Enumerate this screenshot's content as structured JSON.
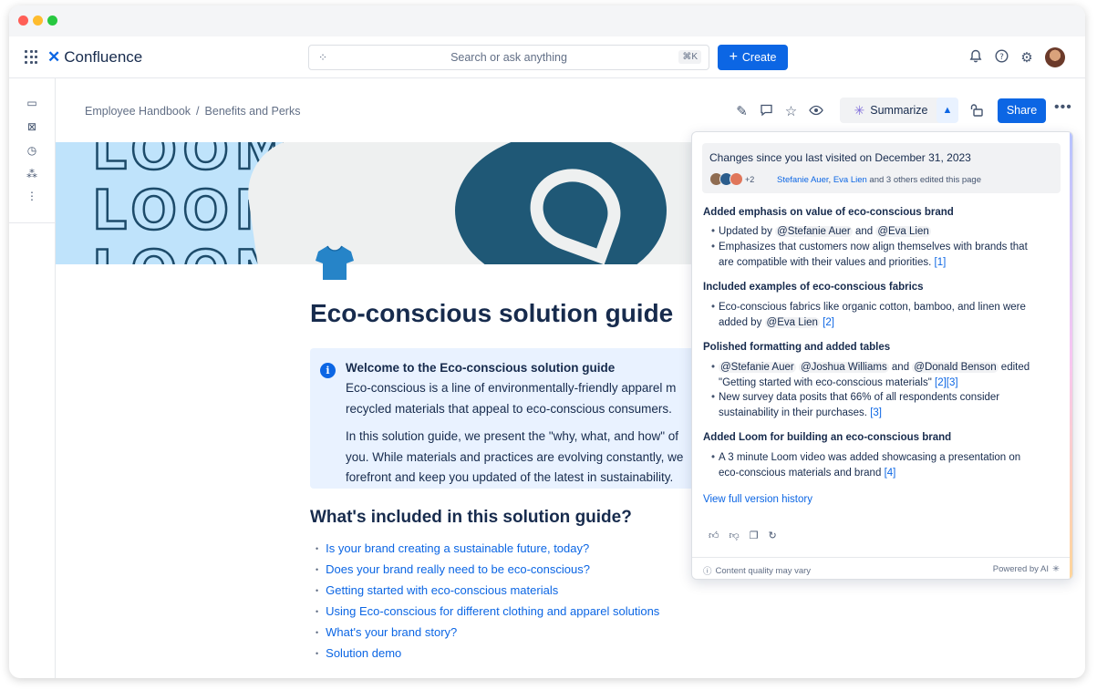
{
  "window": {
    "dots": [
      "#ff5f57",
      "#febc2e",
      "#28c840"
    ]
  },
  "topnav": {
    "app_name": "Confluence",
    "search_placeholder": "Search or ask anything",
    "search_shortcut": "⌘K",
    "create_label": "Create",
    "icons": [
      "bell-icon",
      "help-icon",
      "settings-icon",
      "avatar"
    ]
  },
  "sidebar": {
    "icons": [
      "sidebar-icon",
      "pages-icon",
      "recent-icon",
      "apps-icon",
      "more-icon"
    ]
  },
  "breadcrumb": {
    "items": [
      "Employee Handbook",
      "/",
      "Benefits and Perks"
    ]
  },
  "toolbar": {
    "summarize_label": "Summarize",
    "share_label": "Share"
  },
  "page": {
    "title": "Eco-conscious solution guide",
    "info": {
      "title": "Welcome to the Eco-conscious solution guide",
      "lines": [
        "Eco-conscious is a line of environmentally-friendly apparel m",
        "recycled materials that appeal to eco-conscious consumers.",
        "In this solution guide, we present the \"why, what, and how\" of",
        "you. While materials and practices are evolving constantly, we",
        "forefront and keep you updated of the latest in sustainability."
      ]
    },
    "section_title": "What's included in this solution guide?",
    "toc": [
      "Is your brand creating a sustainable future, today?",
      "Does your brand really need to be eco-conscious?",
      "Getting started with eco-conscious materials",
      "Using Eco-conscious for different clothing and apparel solutions",
      "What's your brand story?",
      "Solution demo"
    ]
  },
  "ai_summary": {
    "changes_title": "Changes since you last visited on December 31, 2023",
    "avatar_extra": "+2",
    "editor_1": "Stefanie Auer",
    "editor_sep": ", ",
    "editor_2": "Eva Lien",
    "editors_suffix": " and 3 others edited this page",
    "s1": {
      "heading": "Added emphasis on value of eco-conscious brand",
      "b1_pre": "Updated by ",
      "b1_m1": "@Stefanie Auer",
      "b1_mid": " and ",
      "b1_m2": "@Eva Lien",
      "b2_l1": "Emphasizes that customers now align themselves with brands that",
      "b2_l2": "are compatible with their values and priorities.",
      "b2_ref": "[1]"
    },
    "s2": {
      "heading": "Included examples of eco-conscious fabrics",
      "b1_l1": "Eco-conscious fabrics like organic cotton, bamboo, and linen were",
      "b1_l2_pre": "added by ",
      "b1_m": "@Eva Lien",
      "b1_ref": "[2]"
    },
    "s3": {
      "heading": "Polished formatting and added tables",
      "b1_m1": "@Stefanie Auer",
      "b1_m2": "@Joshua Williams",
      "b1_and": " and ",
      "b1_m3": "@Donald Benson",
      "b1_edited": " edited",
      "b1_l2": "\"Getting started with eco-conscious materials\"",
      "b1_refs": "[2][3]",
      "b2_l1": "New survey data posits that 66% of all respondents consider",
      "b2_l2": "sustainability in their purchases.",
      "b2_ref": "[3]"
    },
    "s4": {
      "heading": "Added Loom for building an eco-conscious brand",
      "b1_l1": "A 3 minute Loom video was added showcasing a presentation on",
      "b1_l2": "eco-conscious materials and brand",
      "b1_ref": "[4]"
    },
    "version_history": "View full version history",
    "footer_left": "Content quality may vary",
    "footer_right": "Powered by AI"
  }
}
